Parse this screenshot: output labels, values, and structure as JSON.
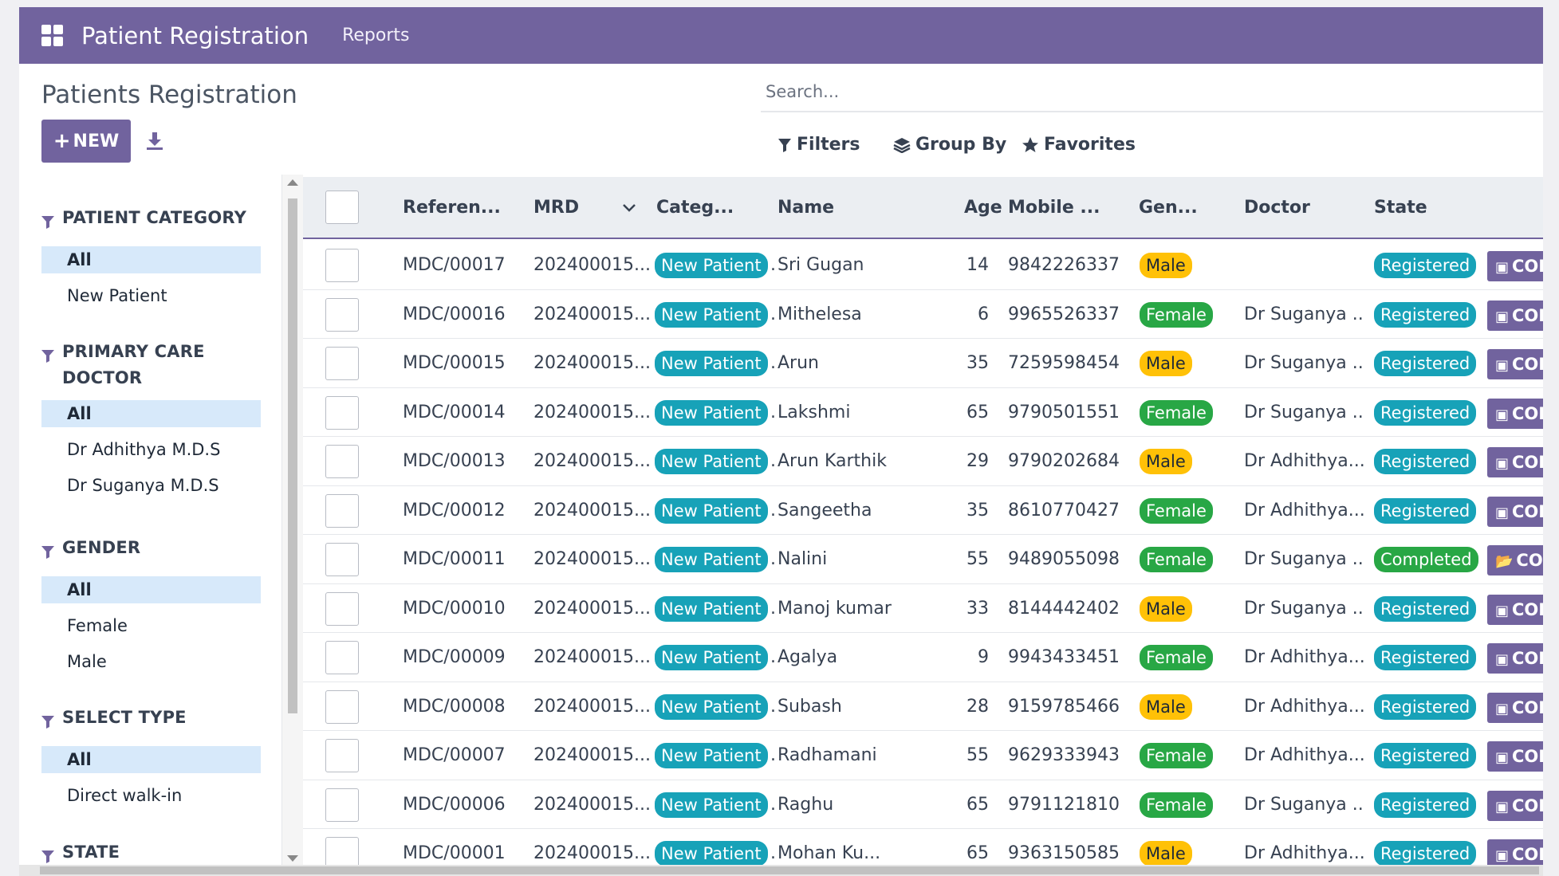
{
  "navbar": {
    "app_title": "Patient Registration",
    "menu_reports": "Reports"
  },
  "control_panel": {
    "page_title": "Patients Registration",
    "search_placeholder": "Search...",
    "new_button": "NEW",
    "filters": "Filters",
    "group_by": "Group By",
    "favorites": "Favorites"
  },
  "sidebar": {
    "sections": [
      {
        "title": "PATIENT CATEGORY",
        "items": [
          "All",
          "New Patient"
        ]
      },
      {
        "title": "PRIMARY CARE DOCTOR",
        "items": [
          "All",
          "Dr Adhithya M.D.S",
          "Dr Suganya M.D.S"
        ]
      },
      {
        "title": "GENDER",
        "items": [
          "All",
          "Female",
          "Male"
        ]
      },
      {
        "title": "SELECT TYPE",
        "items": [
          "All",
          "Direct walk-in"
        ]
      },
      {
        "title": "STATE",
        "items": []
      }
    ]
  },
  "table": {
    "headers": {
      "reference": "Referen...",
      "mrd": "MRD",
      "category": "Categ...",
      "name": "Name",
      "age": "Age",
      "mobile": "Mobile ...",
      "gender": "Gen...",
      "doctor": "Doctor",
      "state": "State"
    },
    "rows": [
      {
        "ref": "MDC/00017",
        "mrd": "202400015...",
        "cat": "New Patient",
        "name": "Sri Gugan",
        "age": "14",
        "mobile": "9842226337",
        "gender": "Male",
        "doctor": "",
        "state": "Registered",
        "action": "COLL"
      },
      {
        "ref": "MDC/00016",
        "mrd": "202400015...",
        "cat": "New Patient",
        "name": "Mithelesa",
        "age": "6",
        "mobile": "9965526337",
        "gender": "Female",
        "doctor": "Dr Suganya ...",
        "state": "Registered",
        "action": "COLL"
      },
      {
        "ref": "MDC/00015",
        "mrd": "202400015...",
        "cat": "New Patient",
        "name": "Arun",
        "age": "35",
        "mobile": "7259598454",
        "gender": "Male",
        "doctor": "Dr Suganya ...",
        "state": "Registered",
        "action": "COLL"
      },
      {
        "ref": "MDC/00014",
        "mrd": "202400015...",
        "cat": "New Patient",
        "name": "Lakshmi",
        "age": "65",
        "mobile": "9790501551",
        "gender": "Female",
        "doctor": "Dr Suganya ...",
        "state": "Registered",
        "action": "COLL"
      },
      {
        "ref": "MDC/00013",
        "mrd": "202400015...",
        "cat": "New Patient",
        "name": "Arun Karthik",
        "age": "29",
        "mobile": "9790202684",
        "gender": "Male",
        "doctor": "Dr Adhithya...",
        "state": "Registered",
        "action": "COLL"
      },
      {
        "ref": "MDC/00012",
        "mrd": "202400015...",
        "cat": "New Patient",
        "name": "Sangeetha",
        "age": "35",
        "mobile": "8610770427",
        "gender": "Female",
        "doctor": "Dr Adhithya...",
        "state": "Registered",
        "action": "COLL"
      },
      {
        "ref": "MDC/00011",
        "mrd": "202400015...",
        "cat": "New Patient",
        "name": "Nalini",
        "age": "55",
        "mobile": "9489055098",
        "gender": "Female",
        "doctor": "Dr Suganya ...",
        "state": "Completed",
        "action": "CONS"
      },
      {
        "ref": "MDC/00010",
        "mrd": "202400015...",
        "cat": "New Patient",
        "name": "Manoj kumar",
        "age": "33",
        "mobile": "8144442402",
        "gender": "Male",
        "doctor": "Dr Suganya ...",
        "state": "Registered",
        "action": "COLL"
      },
      {
        "ref": "MDC/00009",
        "mrd": "202400015...",
        "cat": "New Patient",
        "name": "Agalya",
        "age": "9",
        "mobile": "9943433451",
        "gender": "Female",
        "doctor": "Dr Adhithya...",
        "state": "Registered",
        "action": "COLL"
      },
      {
        "ref": "MDC/00008",
        "mrd": "202400015...",
        "cat": "New Patient",
        "name": "Subash",
        "age": "28",
        "mobile": "9159785466",
        "gender": "Male",
        "doctor": "Dr Adhithya...",
        "state": "Registered",
        "action": "COLL"
      },
      {
        "ref": "MDC/00007",
        "mrd": "202400015...",
        "cat": "New Patient",
        "name": "Radhamani",
        "age": "55",
        "mobile": "9629333943",
        "gender": "Female",
        "doctor": "Dr Adhithya...",
        "state": "Registered",
        "action": "COLL"
      },
      {
        "ref": "MDC/00006",
        "mrd": "202400015...",
        "cat": "New Patient",
        "name": "Raghu",
        "age": "65",
        "mobile": "9791121810",
        "gender": "Female",
        "doctor": "Dr Suganya ...",
        "state": "Registered",
        "action": "COLL"
      },
      {
        "ref": "MDC/00001",
        "mrd": "202400015...",
        "cat": "New Patient",
        "name": "Mohan Ku...",
        "age": "65",
        "mobile": "9363150585",
        "gender": "Male",
        "doctor": "Dr Adhithya...",
        "state": "Registered",
        "action": "COLL"
      }
    ]
  },
  "colors": {
    "brand": "#71639e",
    "badge_teal": "#17a2b8",
    "badge_green": "#28a745",
    "badge_yellow": "#ffc107",
    "active_filter": "#d7e9fa"
  }
}
